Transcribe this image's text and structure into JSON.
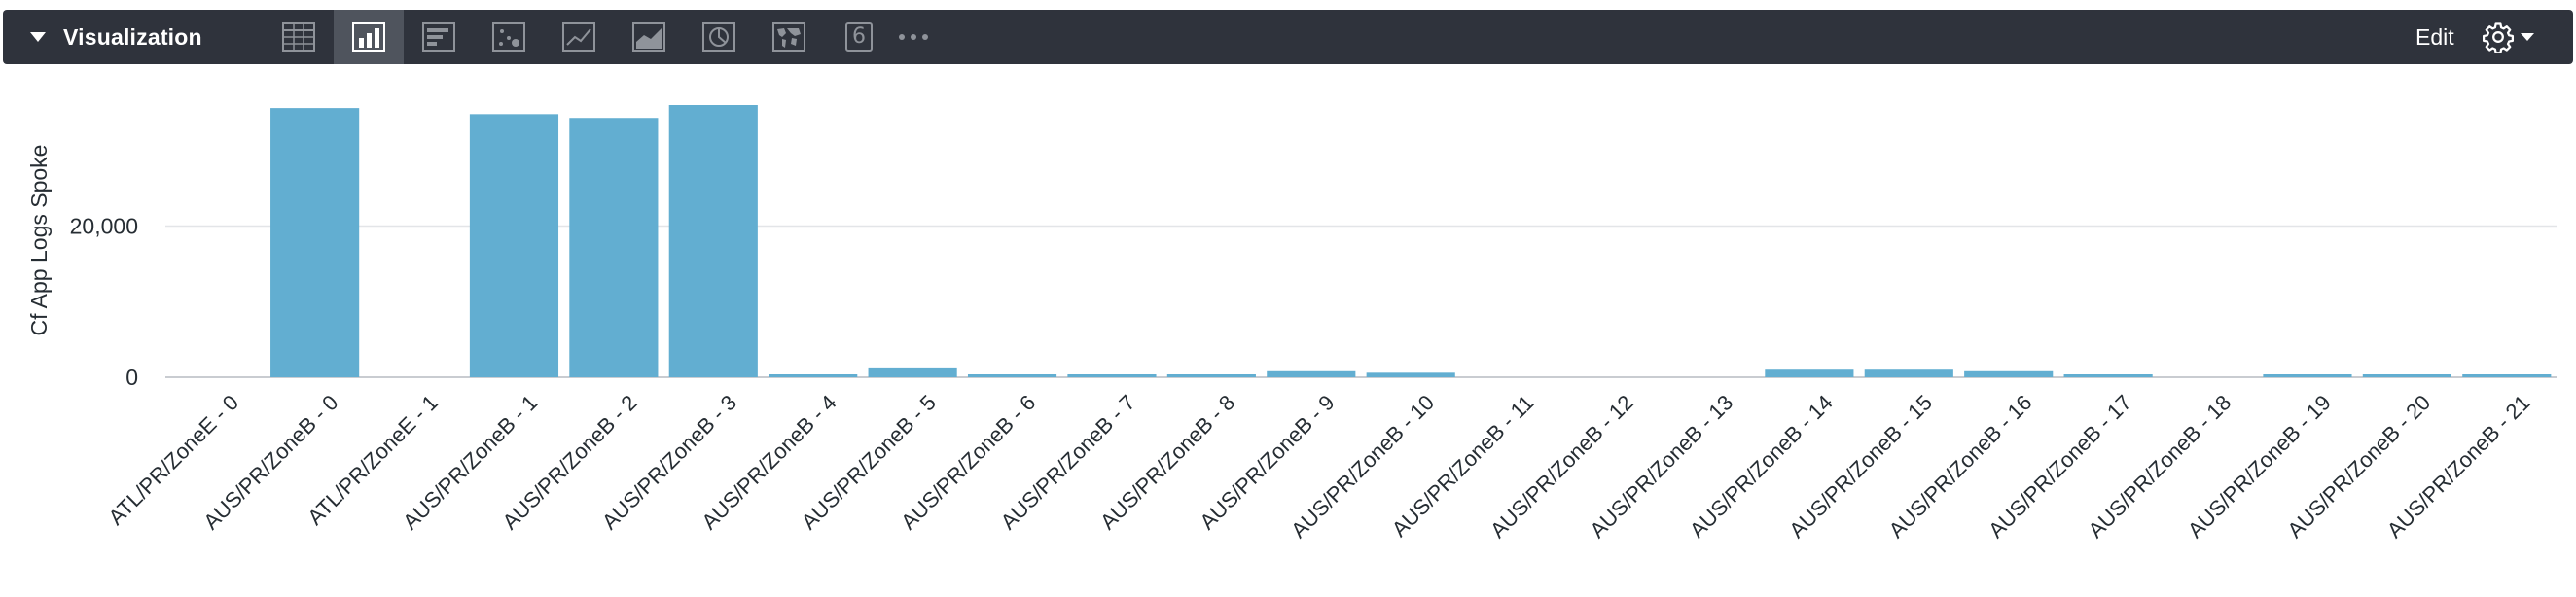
{
  "toolbar": {
    "title": "Visualization",
    "edit_label": "Edit",
    "vis_types": [
      {
        "name": "table",
        "icon": "table-icon"
      },
      {
        "name": "column",
        "icon": "column-chart-icon",
        "active": true
      },
      {
        "name": "bar",
        "icon": "bar-chart-icon"
      },
      {
        "name": "scatter",
        "icon": "scatter-chart-icon"
      },
      {
        "name": "line",
        "icon": "line-chart-icon"
      },
      {
        "name": "area",
        "icon": "area-chart-icon"
      },
      {
        "name": "pie",
        "icon": "pie-chart-icon"
      },
      {
        "name": "map",
        "icon": "map-icon"
      },
      {
        "name": "single-value",
        "icon": "single-value-icon",
        "label": "6"
      },
      {
        "name": "more",
        "icon": "more-icon"
      }
    ]
  },
  "chart_data": {
    "type": "bar",
    "title": "",
    "xlabel": "",
    "ylabel": "Cf App Logs Spoke",
    "ylim": [
      0,
      36000
    ],
    "yticks": [
      0,
      20000
    ],
    "ytick_labels": [
      "0",
      "20,000"
    ],
    "grid": true,
    "bar_color": "#62aed1",
    "categories": [
      "ATL/PR/ZoneE - 0",
      "AUS/PR/ZoneB - 0",
      "ATL/PR/ZoneE - 1",
      "AUS/PR/ZoneB - 1",
      "AUS/PR/ZoneB - 2",
      "AUS/PR/ZoneB - 3",
      "AUS/PR/ZoneB - 4",
      "AUS/PR/ZoneB - 5",
      "AUS/PR/ZoneB - 6",
      "AUS/PR/ZoneB - 7",
      "AUS/PR/ZoneB - 8",
      "AUS/PR/ZoneB - 9",
      "AUS/PR/ZoneB - 10",
      "AUS/PR/ZoneB - 11",
      "AUS/PR/ZoneB - 12",
      "AUS/PR/ZoneB - 13",
      "AUS/PR/ZoneB - 14",
      "AUS/PR/ZoneB - 15",
      "AUS/PR/ZoneB - 16",
      "AUS/PR/ZoneB - 17",
      "AUS/PR/ZoneB - 18",
      "AUS/PR/ZoneB - 19",
      "AUS/PR/ZoneB - 20",
      "AUS/PR/ZoneB - 21"
    ],
    "values": [
      0,
      35600,
      0,
      34800,
      34300,
      36000,
      300,
      1300,
      300,
      300,
      300,
      800,
      600,
      0,
      0,
      0,
      1000,
      1000,
      800,
      300,
      0,
      300,
      300,
      300
    ]
  }
}
